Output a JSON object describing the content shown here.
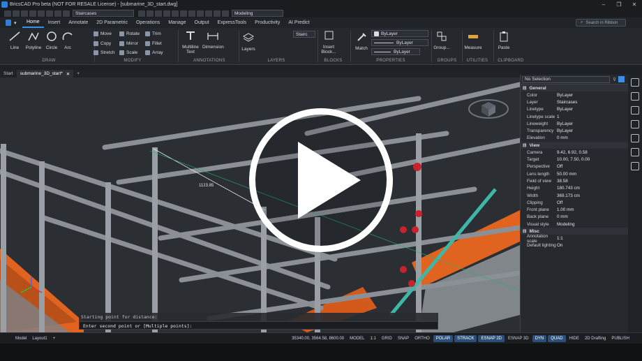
{
  "window": {
    "title": "BricsCAD Pro beta (NOT FOR RESALE License) - [submarine_3D_start.dwg]",
    "min": "–",
    "max": "❐",
    "close": "✕"
  },
  "quick_access": {
    "layer_combo": "Staircases",
    "workspace": "Modeling"
  },
  "tabs": [
    "Home",
    "Insert",
    "Annotate",
    "2D Parametric",
    "Operations",
    "Manage",
    "Output",
    "ExpressTools",
    "Productivity",
    "AI Predict"
  ],
  "search_placeholder": "Search in Ribbon",
  "ribbon": {
    "draw": {
      "label": "DRAW",
      "line": "Line",
      "polyline": "Polyline",
      "circle": "Circle",
      "arc": "Arc"
    },
    "modify": {
      "label": "MODIFY",
      "move": "Move",
      "rotate": "Rotate",
      "trim": "Trim",
      "copy": "Copy",
      "mirror": "Mirror",
      "fillet": "Fillet",
      "stretch": "Stretch",
      "scale": "Scale",
      "array": "Array"
    },
    "annotations": {
      "label": "ANNOTATIONS",
      "mtext": "Multiline Text",
      "dimension": "Dimension"
    },
    "layers": {
      "label": "LAYERS",
      "layers": "Layers",
      "current": "Stairc"
    },
    "blocks": {
      "label": "BLOCKS",
      "insert": "Insert Block..."
    },
    "properties": {
      "label": "PROPERTIES",
      "match": "Match",
      "color": "ByLayer",
      "linetype": "ByLayer",
      "lineweight": "ByLayer"
    },
    "groups": {
      "label": "GROUPS",
      "group": "Group..."
    },
    "utilities": {
      "label": "UTILITIES",
      "measure": "Measure"
    },
    "clipboard": {
      "label": "CLIPBOARD",
      "paste": "Paste"
    }
  },
  "doc_tabs": [
    "Start",
    "submarine_3D_start*"
  ],
  "viewport": {
    "dimension_text": "1123.85"
  },
  "command": {
    "line1": "Starting point for distance:",
    "line2": "Enter second point or [Multiple points]:"
  },
  "properties": {
    "selection": "No Selection",
    "general": {
      "title": "General",
      "rows": [
        {
          "k": "Color",
          "v": "ByLayer"
        },
        {
          "k": "Layer",
          "v": "Staircases"
        },
        {
          "k": "Linetype",
          "v": "ByLayer"
        },
        {
          "k": "Linetype scale",
          "v": "1"
        },
        {
          "k": "Lineweight",
          "v": "ByLayer"
        },
        {
          "k": "Transparency",
          "v": "ByLayer"
        },
        {
          "k": "Elevation",
          "v": "0 mm"
        }
      ]
    },
    "view": {
      "title": "View",
      "rows": [
        {
          "k": "Camera",
          "v": "9.42, 6.92, 0.58"
        },
        {
          "k": "Target",
          "v": "10.00, 7.50, 0.00"
        },
        {
          "k": "Perspective",
          "v": "Off"
        },
        {
          "k": "Lens length",
          "v": "50.00 mm"
        },
        {
          "k": "Field of view",
          "v": "38.58"
        },
        {
          "k": "Height",
          "v": "180.743 cm"
        },
        {
          "k": "Width",
          "v": "369.173 cm"
        },
        {
          "k": "Clipping",
          "v": "Off"
        },
        {
          "k": "Front plane",
          "v": "1.00 mm"
        },
        {
          "k": "Back plane",
          "v": "0 mm"
        },
        {
          "k": "Visual style",
          "v": "Modeling"
        }
      ]
    },
    "misc": {
      "title": "Misc",
      "rows": [
        {
          "k": "Annotation scale",
          "v": "1:1"
        },
        {
          "k": "Default lighting",
          "v": "On"
        }
      ]
    }
  },
  "status": {
    "model_tab": "Model",
    "layout_tab": "Layout1",
    "coords": "35340.00, 3564.58, 8600.00",
    "model": "MODEL",
    "scale": "1:1",
    "items": [
      "GRID",
      "SNAP",
      "ORTHO",
      "POLAR",
      "STRACK",
      "ESNAP 2D",
      "ESNAP 3D",
      "DYN",
      "QUAD",
      "HIDE",
      "2D Drafting",
      "PUBLISH"
    ]
  }
}
